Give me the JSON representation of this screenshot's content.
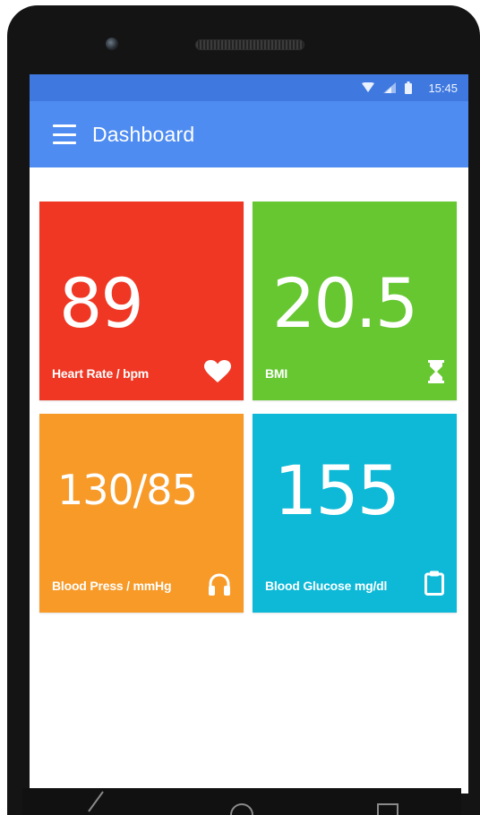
{
  "status_bar": {
    "time": "15:45",
    "icons": [
      "wifi-icon",
      "signal-icon",
      "battery-icon"
    ]
  },
  "app_bar": {
    "title": "Dashboard",
    "menu_icon": "hamburger-menu-icon"
  },
  "tiles": [
    {
      "value": "89",
      "label": "Heart Rate / bpm",
      "icon": "heart-icon",
      "color": "#ef3723"
    },
    {
      "value": "20.5",
      "label": "BMI",
      "icon": "hourglass-icon",
      "color": "#66c731"
    },
    {
      "value": "130/85",
      "label": "Blood Press / mmHg",
      "icon": "headphones-icon",
      "color": "#f79a28"
    },
    {
      "value": "155",
      "label": "Blood Glucose mg/dl",
      "icon": "clipboard-icon",
      "color": "#0db9d7"
    }
  ],
  "nav_bar": {
    "buttons": [
      "back-icon",
      "home-icon",
      "recents-icon"
    ]
  },
  "colors": {
    "status_bar": "#3f79e0",
    "app_bar": "#4e8cf1"
  }
}
